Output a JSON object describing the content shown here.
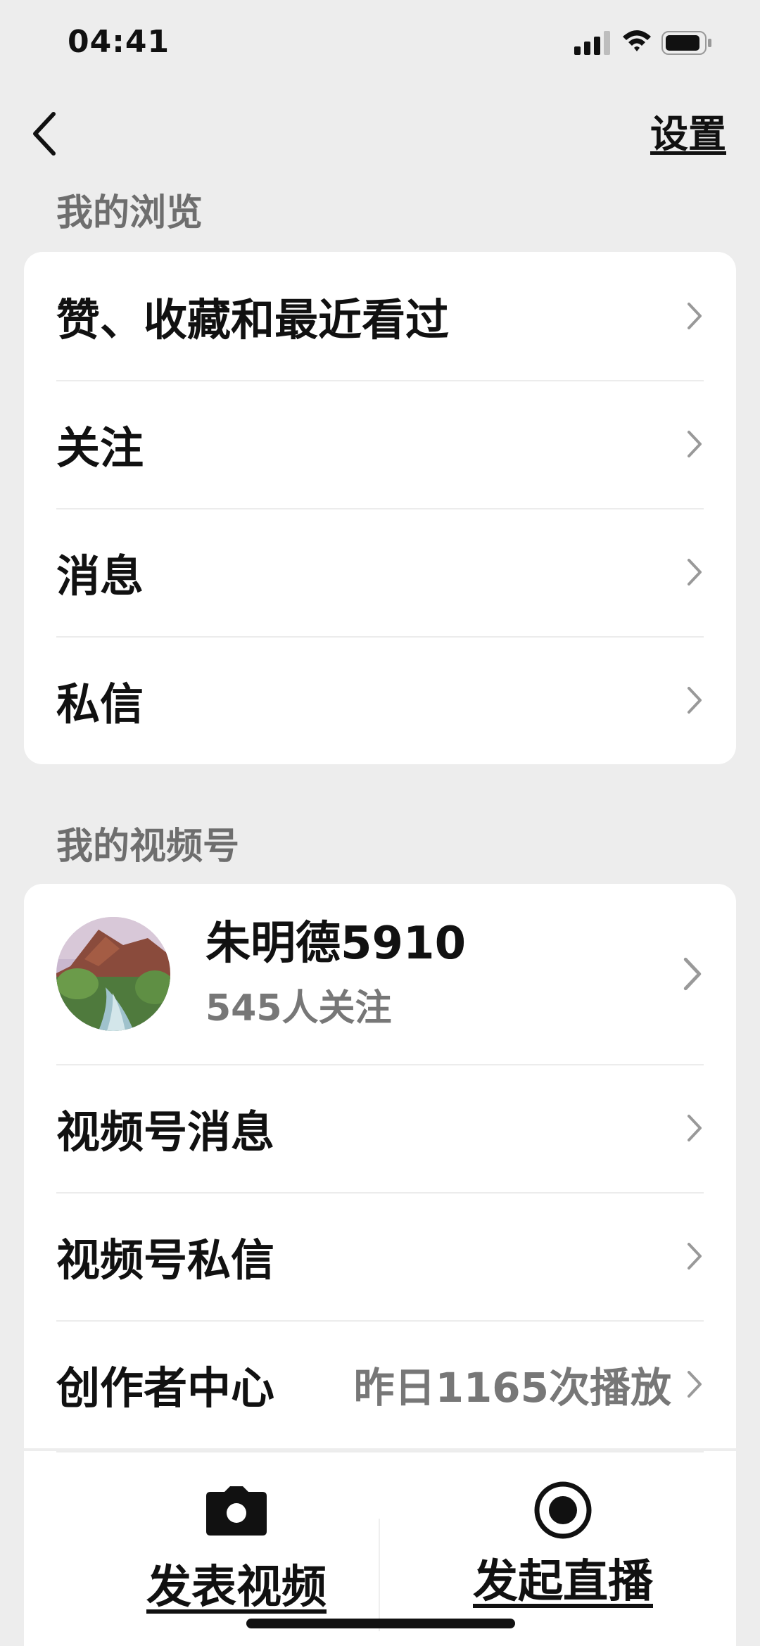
{
  "status_bar": {
    "time": "04:41"
  },
  "nav": {
    "settings_label": "设置"
  },
  "browse_section": {
    "title": "我的浏览",
    "items": [
      {
        "label": "赞、收藏和最近看过"
      },
      {
        "label": "关注"
      },
      {
        "label": "消息"
      },
      {
        "label": "私信"
      }
    ]
  },
  "channels_section": {
    "title": "我的视频号",
    "profile": {
      "name": "朱明德5910",
      "followers": "545人关注"
    },
    "items": [
      {
        "label": "视频号消息"
      },
      {
        "label": "视频号私信"
      },
      {
        "label": "创作者中心",
        "value": "昨日1165次播放"
      }
    ]
  },
  "bottom_actions": {
    "publish_video": "发表视频",
    "start_live": "发起直播"
  }
}
